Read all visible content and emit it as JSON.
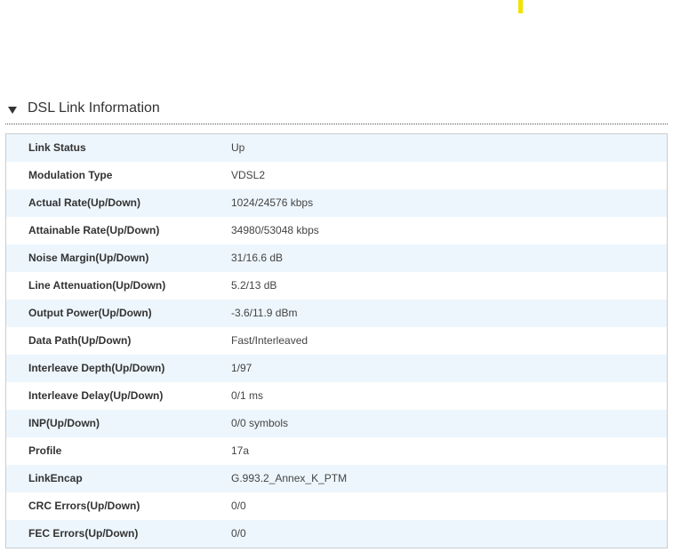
{
  "section": {
    "title": "DSL Link Information"
  },
  "colors": {
    "accent": "#f2e200",
    "row_stripe": "#edf6fd",
    "border": "#cccccc"
  },
  "rows": [
    {
      "label": "Link Status",
      "value": "Up"
    },
    {
      "label": "Modulation Type",
      "value": "VDSL2"
    },
    {
      "label": "Actual Rate(Up/Down)",
      "value": "1024/24576 kbps"
    },
    {
      "label": "Attainable Rate(Up/Down)",
      "value": "34980/53048 kbps"
    },
    {
      "label": "Noise Margin(Up/Down)",
      "value": "31/16.6 dB"
    },
    {
      "label": "Line Attenuation(Up/Down)",
      "value": "5.2/13 dB"
    },
    {
      "label": "Output Power(Up/Down)",
      "value": "-3.6/11.9 dBm"
    },
    {
      "label": "Data Path(Up/Down)",
      "value": "Fast/Interleaved"
    },
    {
      "label": "Interleave Depth(Up/Down)",
      "value": "1/97"
    },
    {
      "label": "Interleave Delay(Up/Down)",
      "value": "0/1 ms"
    },
    {
      "label": "INP(Up/Down)",
      "value": "0/0 symbols"
    },
    {
      "label": "Profile",
      "value": "17a"
    },
    {
      "label": "LinkEncap",
      "value": "G.993.2_Annex_K_PTM"
    },
    {
      "label": "CRC Errors(Up/Down)",
      "value": "0/0"
    },
    {
      "label": "FEC Errors(Up/Down)",
      "value": "0/0"
    }
  ]
}
